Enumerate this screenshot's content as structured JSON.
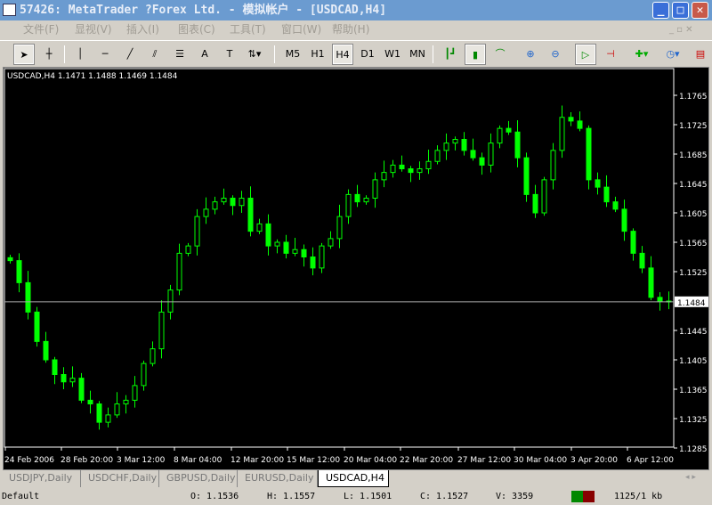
{
  "window": {
    "title": "57426: MetaTrader ?Forex Ltd. - 模拟帐户 - [USDCAD,H4]"
  },
  "menu": [
    "文件(F)",
    "显视(V)",
    "插入(I)",
    "图表(C)",
    "工具(T)",
    "窗口(W)",
    "帮助(H)"
  ],
  "toolbar": {
    "timeframes": [
      "M5",
      "H1",
      "H4",
      "D1",
      "W1",
      "MN"
    ],
    "active_timeframe": "H4",
    "text_tool": "A"
  },
  "chart": {
    "info": "USDCAD,H4  1.1471 1.1488 1.1469 1.1484",
    "current_price": "1.1484",
    "price_labels": [
      "1.1765",
      "1.1725",
      "1.1685",
      "1.1645",
      "1.1605",
      "1.1565",
      "1.1525",
      "1.1445",
      "1.1405",
      "1.1365",
      "1.1325",
      "1.1285"
    ],
    "time_labels": [
      "24 Feb 2006",
      "28 Feb 20:00",
      "3 Mar 12:00",
      "8 Mar 04:00",
      "12 Mar 20:00",
      "15 Mar 12:00",
      "20 Mar 04:00",
      "22 Mar 20:00",
      "27 Mar 12:00",
      "30 Mar 04:00",
      "3 Apr 20:00",
      "6 Apr 12:00"
    ],
    "bull_color": "#00ff00",
    "bear_color": "#00ff00"
  },
  "chart_data": {
    "type": "candlestick",
    "symbol": "USDCAD",
    "timeframe": "H4",
    "ylim": [
      1.1285,
      1.1765
    ],
    "closes": [
      1.154,
      1.151,
      1.147,
      1.143,
      1.1405,
      1.1385,
      1.1375,
      1.138,
      1.135,
      1.1345,
      1.132,
      1.133,
      1.1345,
      1.135,
      1.137,
      1.14,
      1.142,
      1.147,
      1.15,
      1.155,
      1.156,
      1.16,
      1.161,
      1.162,
      1.1625,
      1.1615,
      1.1625,
      1.158,
      1.159,
      1.156,
      1.1565,
      1.155,
      1.1555,
      1.1545,
      1.153,
      1.156,
      1.157,
      1.16,
      1.163,
      1.162,
      1.1625,
      1.165,
      1.166,
      1.167,
      1.1665,
      1.166,
      1.1665,
      1.1675,
      1.169,
      1.17,
      1.1705,
      1.169,
      1.168,
      1.167,
      1.17,
      1.172,
      1.1715,
      1.168,
      1.163,
      1.1605,
      1.165,
      1.169,
      1.1735,
      1.173,
      1.172,
      1.165,
      1.164,
      1.162,
      1.161,
      1.158,
      1.155,
      1.153,
      1.149,
      1.1485,
      1.1484
    ]
  },
  "tabs": [
    {
      "label": "USDJPY,Daily"
    },
    {
      "label": "USDCHF,Daily"
    },
    {
      "label": "GBPUSD,Daily"
    },
    {
      "label": "EURUSD,Daily"
    },
    {
      "label": "USDCAD,H4",
      "active": true
    }
  ],
  "status": {
    "profile": "Default",
    "open": "O: 1.1536",
    "high": "H: 1.1557",
    "low": "L: 1.1501",
    "close": "C: 1.1527",
    "volume": "V: 3359",
    "traffic": "1125/1 kb"
  }
}
